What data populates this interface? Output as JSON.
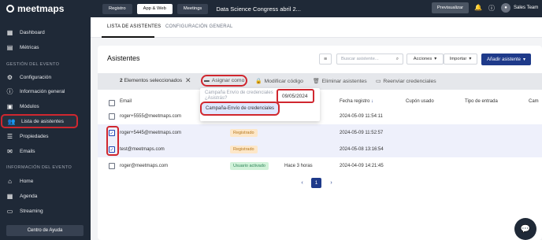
{
  "app": {
    "logo_text": "meetmaps"
  },
  "topbar": {
    "tabs": [
      "Registro",
      "App & Web",
      "Meetings"
    ],
    "event_title": "Data Science Congress abril 2...",
    "preview_label": "Previsualizar",
    "user_name": "Sales Team"
  },
  "sidebar": {
    "items_top": [
      "Dashboard",
      "Métricas"
    ],
    "section_event": "GESTIÓN DEL EVENTO",
    "items_event": [
      "Configuración",
      "Información general",
      "Módulos",
      "Lista de asistentes",
      "Propiedades",
      "Emails"
    ],
    "section_info": "INFORMACIÓN DEL EVENTO",
    "items_info": [
      "Home",
      "Agenda",
      "Streaming"
    ],
    "help_label": "Centro de Ayuda"
  },
  "page_tabs": [
    "LISTA DE ASISTENTES",
    "CONFIGURACIÓN GENERAL"
  ],
  "card": {
    "title": "Asistentes",
    "search_placeholder": "Buscar asistente...",
    "actions_label": "Acciones",
    "import_label": "Importar",
    "add_label": "Añadir asistente"
  },
  "bulk": {
    "count": "2",
    "count_label": "Elementos seleccionados",
    "actions": [
      "Asignar como",
      "Modificar código",
      "Eliminar asistentes",
      "Reenviar credenciales"
    ]
  },
  "dropdown": {
    "faded_line1": "Campaña Envío de credenciales",
    "faded_line2": "¿Asistrás?",
    "highlight_item": "Campaña-Envío de credenciales",
    "date_value": "09/05/2024"
  },
  "table": {
    "headers": [
      "Email",
      "Fecha registro",
      "Cupón usado",
      "Tipo de entrada",
      "Cam"
    ],
    "rows": [
      {
        "email": "roger+5555@meetmaps.com",
        "status": "",
        "extra": "",
        "date": "2024-05-09 11:54:11",
        "checked": false
      },
      {
        "email": "roger+5445@meetmaps.com",
        "status": "Registrado",
        "extra": "",
        "date": "2024-05-09 11:52:57",
        "checked": true
      },
      {
        "email": "test@meetmaps.com",
        "status": "Registrado",
        "extra": "",
        "date": "2024-05-08 13:16:54",
        "checked": true
      },
      {
        "email": "roger@meetmaps.com",
        "status": "Usuario activado",
        "extra": "Hace 3 horas",
        "date": "2024-04-09 14:21:45",
        "checked": false
      }
    ]
  },
  "pagination": {
    "prev": "‹",
    "current": "1",
    "next": "›"
  },
  "colors": {
    "accent": "#1e3a8a",
    "highlight": "#d0272f",
    "sidebar": "#1f2937"
  }
}
